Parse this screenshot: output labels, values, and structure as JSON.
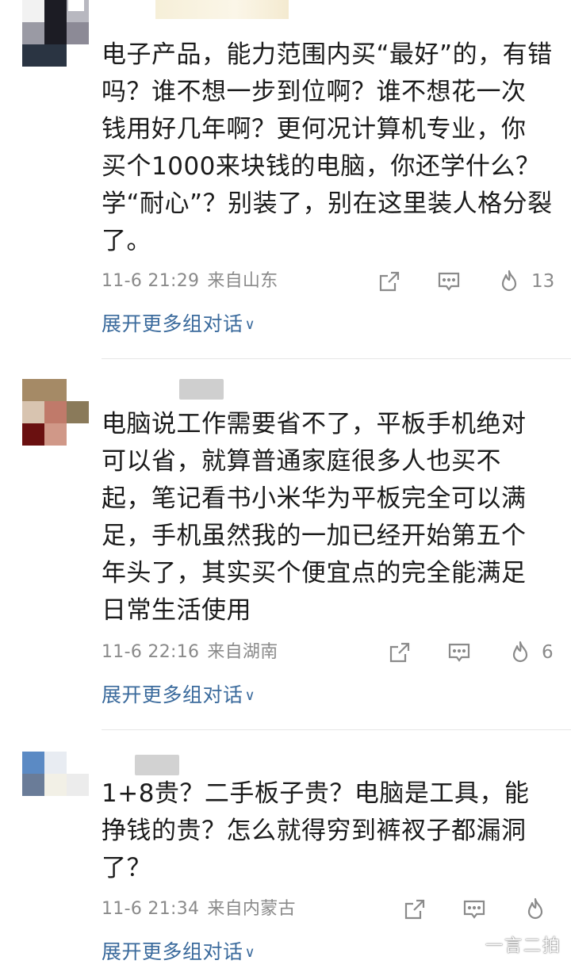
{
  "comments": [
    {
      "lines": [
        "电子产品，能力范围内买“最好”的，有错",
        "吗？谁不想一步到位啊？谁不想花一次",
        "钱用好几年啊？更何况计算机专业，你",
        "买个1000来块钱的电脑，你还学什么？",
        "学“耐心”？别装了，别在这里装人格分裂",
        "了。"
      ],
      "time": "11-6 21:29",
      "location": "来自山东",
      "likes": "13",
      "expand_label": "展开更多组对话"
    },
    {
      "lines": [
        "电脑说工作需要省不了，平板手机绝对",
        "可以省，就算普通家庭很多人也买不",
        "起，笔记看书小米华为平板完全可以满",
        "足，手机虽然我的一加已经开始第五个",
        "年头了，其实买个便宜点的完全能满足",
        "日常生活使用"
      ],
      "time": "11-6 22:16",
      "location": "来自湖南",
      "likes": "6",
      "expand_label": "展开更多组对话"
    },
    {
      "lines": [
        "1+8贵？二手板子贵？电脑是工具，能",
        "挣钱的贵？怎么就得穷到裤衩子都漏洞",
        "了？"
      ],
      "time": "11-6 21:34",
      "location": "来自内蒙古",
      "likes": "",
      "expand_label": "展开更多组对话"
    }
  ],
  "icons": {
    "share": "share-icon",
    "comment": "comment-icon",
    "like": "flame-like-icon"
  },
  "colors": {
    "link": "#3a6a9c",
    "meta": "#8a8a8a"
  },
  "watermark": "一言二拍"
}
